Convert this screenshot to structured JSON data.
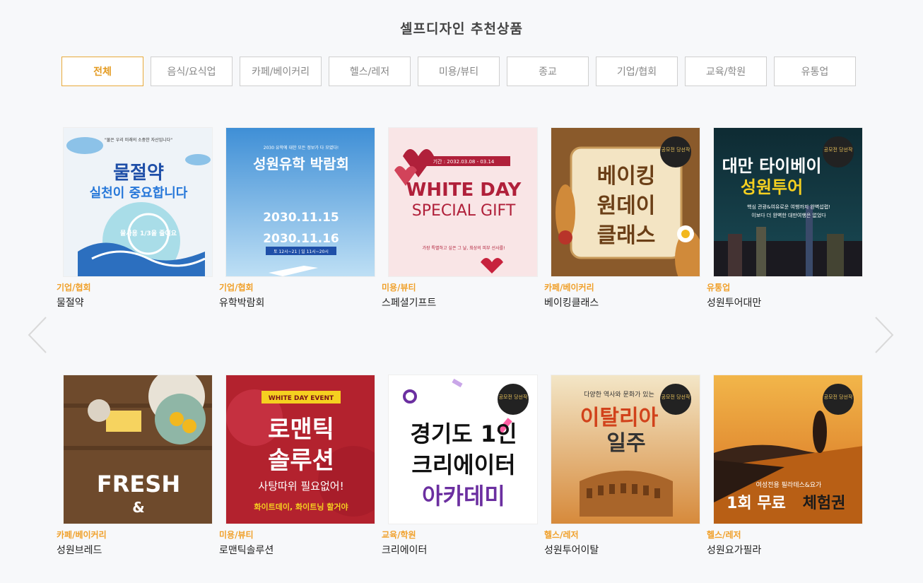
{
  "section": {
    "title": "셀프디자인 추천상품"
  },
  "tabs": [
    {
      "label": "전체",
      "active": true
    },
    {
      "label": "음식/요식업"
    },
    {
      "label": "카페/베이커리"
    },
    {
      "label": "헬스/레저"
    },
    {
      "label": "미용/뷰티"
    },
    {
      "label": "종교"
    },
    {
      "label": "기업/협회"
    },
    {
      "label": "교육/학원"
    },
    {
      "label": "유통업"
    }
  ],
  "products": [
    {
      "category": "기업/협회",
      "name": "물절약",
      "poster": {
        "top": "\"물은 우리 미래의 소중한 자산입니다\"",
        "line1": "물절약",
        "line2": "실천이 중요합니다",
        "badge": "물사용 1/3을 줄여요"
      }
    },
    {
      "category": "기업/협회",
      "name": "유학박람회",
      "poster": {
        "top": "2030 유학에 대한 모든 정보가 다 모였다!",
        "line1": "성원유학 박람회",
        "date1": "2030.11.15",
        "date2": "2030.11.16",
        "time": "토 12시~21 | 일 11시~20시"
      }
    },
    {
      "category": "미용/뷰티",
      "name": "스페셜기프트",
      "poster": {
        "period": "기간 : 2032.03.08 - 03.14",
        "line1": "WHITE DAY",
        "line2": "SPECIAL GIFT",
        "note": "가장 특별하고 싶은 그 날, 최상의 피부 선사를!"
      }
    },
    {
      "category": "카페/베이커리",
      "name": "베이킹클래스",
      "poster": {
        "line1": "베이킹",
        "line2": "원데이",
        "line3": "클래스",
        "award": "공모전 당선작"
      }
    },
    {
      "category": "유통업",
      "name": "성원투어대만",
      "poster": {
        "line1": "대만 타이베이",
        "line2": "성원투어",
        "sub1": "핵심 관광&여유로운 여행까지 완벽섭렵!",
        "sub2": "이보다 더 완벽한 대만여행은 없었다",
        "award": "공모전 당선작"
      }
    },
    {
      "category": "카페/베이커리",
      "name": "성원브레드",
      "poster": {
        "line1": "FRESH",
        "line2": "&"
      }
    },
    {
      "category": "미용/뷰티",
      "name": "로맨틱솔루션",
      "poster": {
        "ribbon": "WHITE DAY EVENT",
        "line1": "로맨틱",
        "line2": "솔루션",
        "line3": "사탕따위 필요없어!",
        "line4": "화이트데이, 화이트닝 할거야"
      }
    },
    {
      "category": "교육/학원",
      "name": "크리에이터",
      "poster": {
        "line1": "경기도 1인",
        "line2": "크리에이터",
        "line3": "아카데미",
        "award": "공모전 당선작"
      }
    },
    {
      "category": "헬스/레저",
      "name": "성원투어이탈",
      "poster": {
        "top": "다양한 역사와 문화가 있는",
        "line1": "이탈리아",
        "line2": "일주",
        "award": "공모전 당선작"
      }
    },
    {
      "category": "헬스/레저",
      "name": "성원요가필라",
      "poster": {
        "sub": "여성전용 필라테스&요가",
        "line1": "1회 무료",
        "line2": "체험권",
        "award": "공모전 당선작"
      }
    }
  ],
  "colors": {
    "accent": "#e49b21",
    "category": "#f0a02a"
  }
}
